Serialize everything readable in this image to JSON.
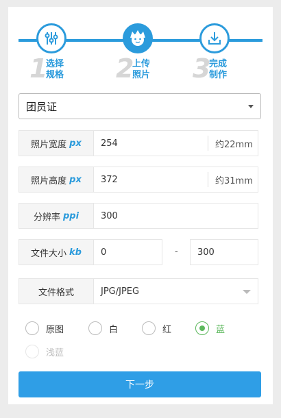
{
  "steps": [
    {
      "num": "1",
      "label_line1": "选择",
      "label_line2": "规格",
      "icon": "sliders-icon"
    },
    {
      "num": "2",
      "label_line1": "上传",
      "label_line2": "照片",
      "icon": "face-icon"
    },
    {
      "num": "3",
      "label_line1": "完成",
      "label_line2": "制作",
      "icon": "download-icon"
    }
  ],
  "spec_select": {
    "value": "团员证"
  },
  "width_row": {
    "label": "照片宽度",
    "unit": "px",
    "value": "254",
    "suffix": "约22mm"
  },
  "height_row": {
    "label": "照片高度",
    "unit": "px",
    "value": "372",
    "suffix": "约31mm"
  },
  "dpi_row": {
    "label": "分辨率",
    "unit": "ppi",
    "value": "300"
  },
  "size_row": {
    "label": "文件大小",
    "unit": "kb",
    "min": "0",
    "separator": "-",
    "max": "300"
  },
  "format_row": {
    "label": "文件格式",
    "value": "JPG/JPEG"
  },
  "background_options": [
    {
      "label": "原图",
      "checked": false
    },
    {
      "label": "白",
      "checked": false
    },
    {
      "label": "红",
      "checked": false
    },
    {
      "label": "蓝",
      "checked": true
    },
    {
      "label": "浅蓝",
      "checked": false,
      "disabled": true
    }
  ],
  "next_button": {
    "label": "下一步"
  },
  "colors": {
    "accent": "#2b9bdc",
    "button": "#2f9ee6",
    "checked": "#5cb85c"
  }
}
